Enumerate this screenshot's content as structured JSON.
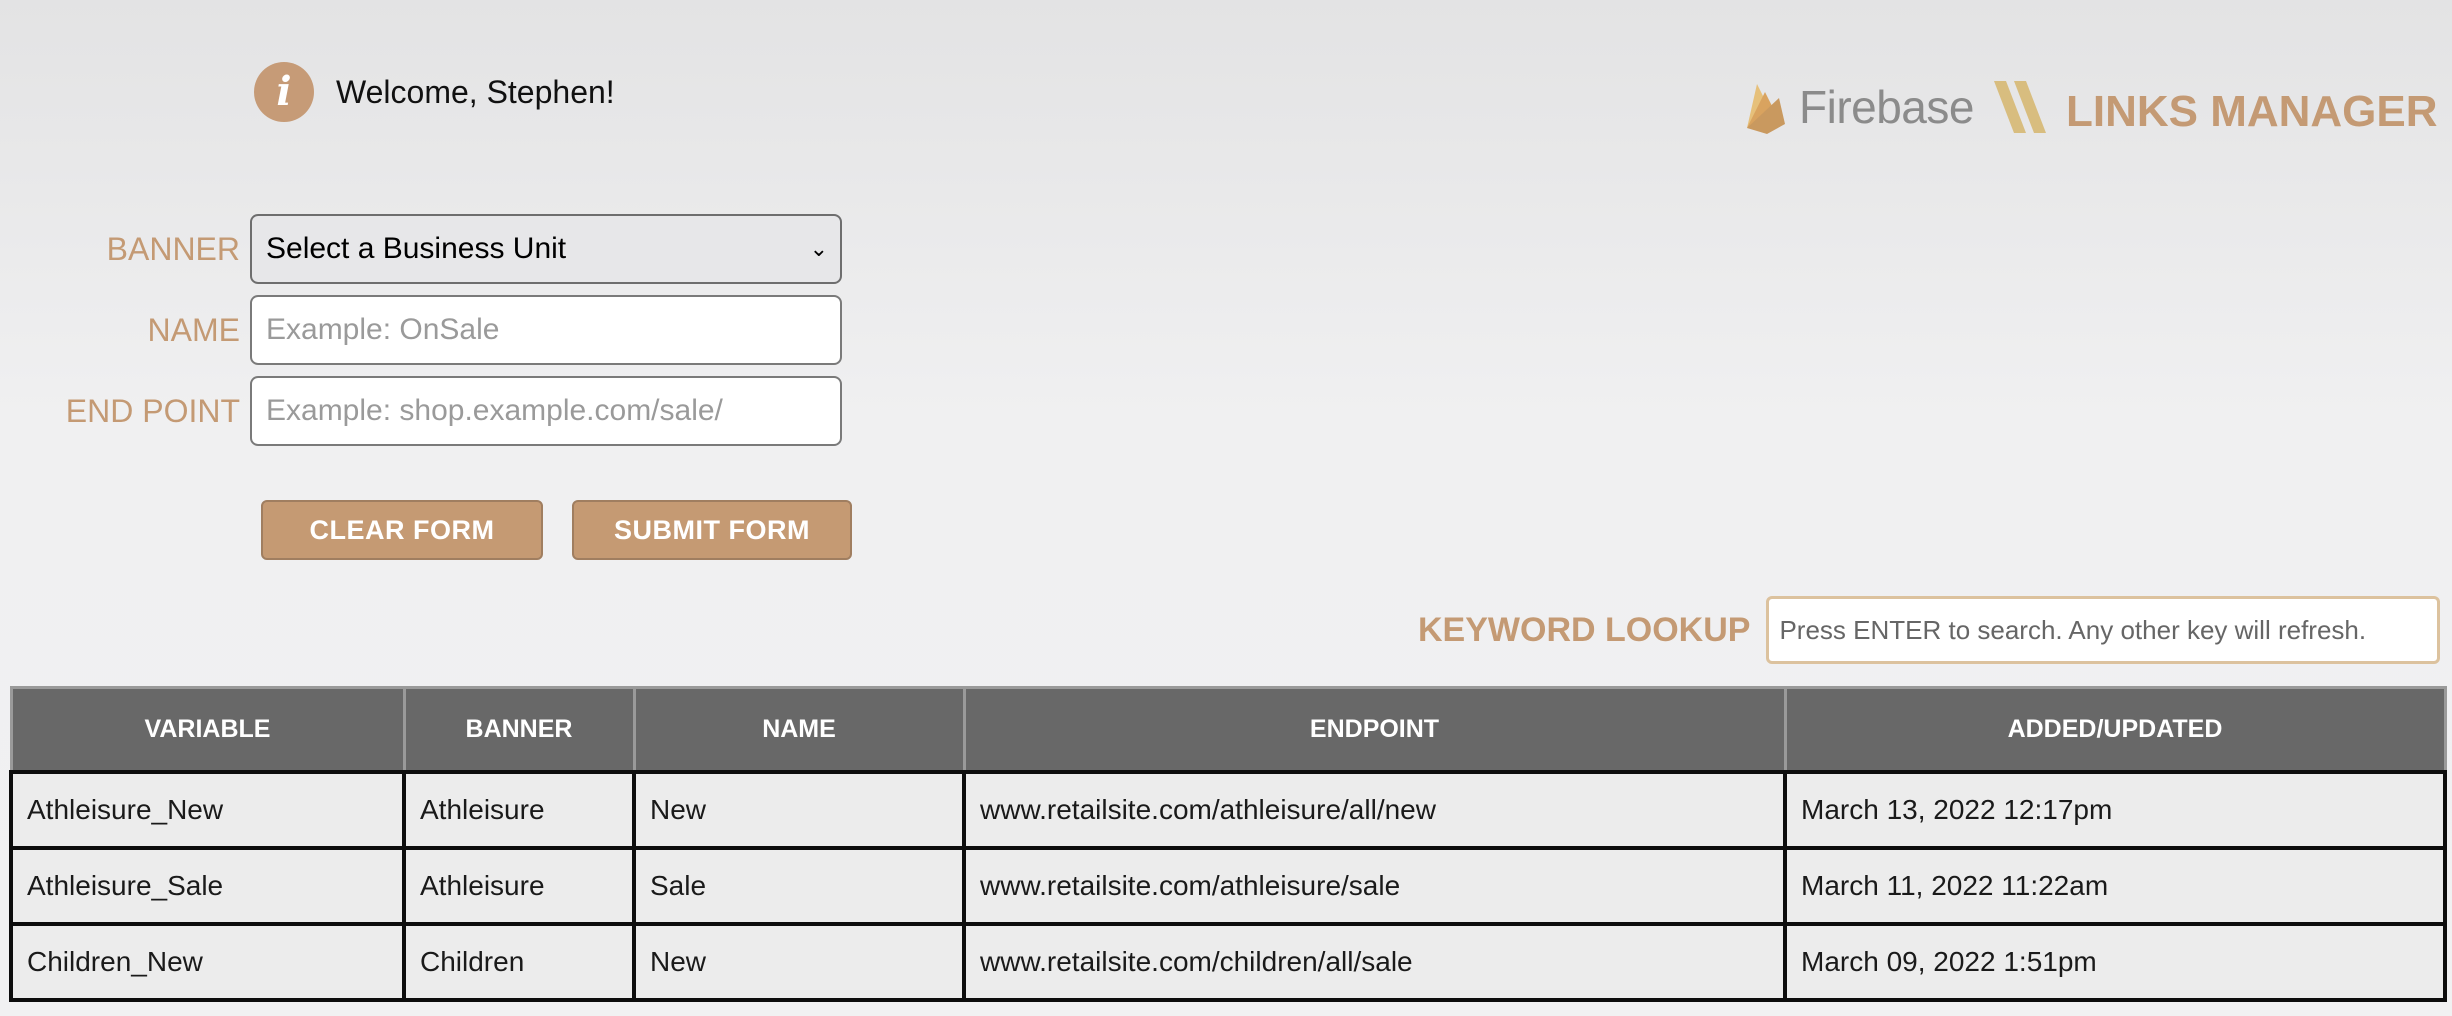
{
  "header": {
    "welcome": "Welcome, Stephen!",
    "info_icon": "info-icon",
    "logo": {
      "firebase": "Firebase",
      "product": "LINKS MANAGER",
      "flame_colors": [
        "#e6c07a",
        "#d9a35f",
        "#c9995f"
      ],
      "slash_color": "#d8bd7f"
    }
  },
  "form": {
    "banner_label": "BANNER",
    "banner_value": "Select a Business Unit",
    "name_label": "NAME",
    "name_placeholder": "Example: OnSale",
    "endpoint_label": "END POINT",
    "endpoint_placeholder": "Example: shop.example.com/sale/",
    "clear_label": "CLEAR FORM",
    "submit_label": "SUBMIT FORM"
  },
  "lookup": {
    "label": "KEYWORD LOOKUP",
    "placeholder": "Press ENTER to search. Any other key will refresh."
  },
  "colors": {
    "accent": "#c49a74",
    "header_bg": "#686868",
    "row_bg": "#ececec"
  },
  "table": {
    "columns": [
      "VARIABLE",
      "BANNER",
      "NAME",
      "ENDPOINT",
      "ADDED/UPDATED"
    ],
    "rows": [
      [
        "Athleisure_New",
        "Athleisure",
        "New",
        "www.retailsite.com/athleisure/all/new",
        "March 13, 2022 12:17pm"
      ],
      [
        "Athleisure_Sale",
        "Athleisure",
        "Sale",
        "www.retailsite.com/athleisure/sale",
        "March 11, 2022 11:22am"
      ],
      [
        "Children_New",
        "Children",
        "New",
        "www.retailsite.com/children/all/sale",
        "March 09, 2022 1:51pm"
      ]
    ]
  }
}
